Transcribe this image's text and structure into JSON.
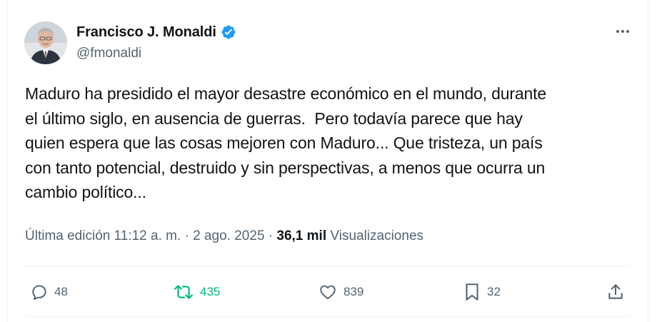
{
  "author": {
    "display_name": "Francisco J. Monaldi",
    "handle": "@fmonaldi",
    "verified": true,
    "verified_color": "#1d9bf0"
  },
  "tweet": {
    "text": "Maduro ha presidido el mayor desastre económico en el mundo, durante\nel último siglo, en ausencia de guerras.  Pero todavía parece que hay\nquien espera que las cosas mejoren con Maduro... Que tristeza, un país\ncon tanto potencial, destruido y sin perspectivas, a menos que ocurra un\ncambio político...",
    "meta_prefix": "Última edición 11:12 a. m. · 2 ago. 2025 · ",
    "views_count": "36,1 mil",
    "views_label": "Visualizaciones"
  },
  "actions": {
    "reply": {
      "icon": "reply-icon",
      "count": "48"
    },
    "retweet": {
      "icon": "retweet-icon",
      "count": "435",
      "color": "#00ba7c"
    },
    "like": {
      "icon": "heart-icon",
      "count": "839"
    },
    "bookmark": {
      "icon": "bookmark-icon",
      "count": "32"
    },
    "share": {
      "icon": "share-icon"
    }
  }
}
